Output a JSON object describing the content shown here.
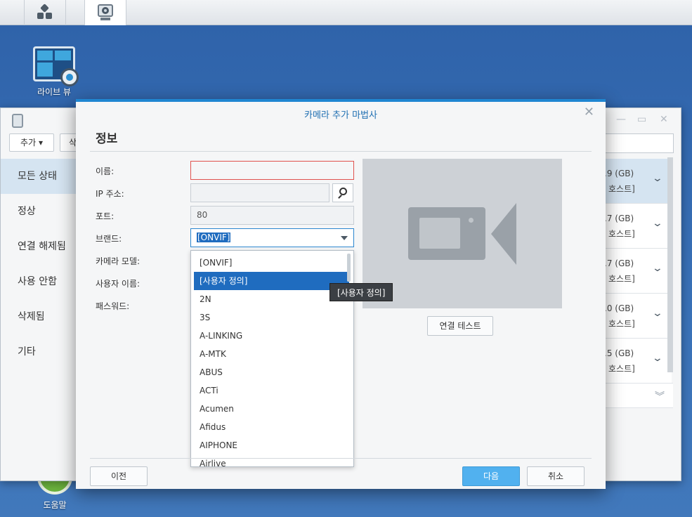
{
  "desktop": {
    "icons": [
      {
        "label": "라이브 뷰"
      },
      {
        "label": "도움말"
      }
    ]
  },
  "background_window": {
    "add_button": "추가",
    "add_button_2": "삭",
    "sidebar": [
      "모든 상태",
      "정상",
      "연결 해제됨",
      "사용 안함",
      "삭제됨",
      "기타"
    ],
    "cameras": [
      {
        "size": ".9 (GB)",
        "host": "호스트]"
      },
      {
        "size": ".7 (GB)",
        "host": "호스트]"
      },
      {
        "size": ".7 (GB)",
        "host": "호스트]"
      },
      {
        "size": ".0 (GB)",
        "host": "호스트]"
      },
      {
        "size": ".5 (GB)",
        "host": "호스트]"
      }
    ]
  },
  "dialog": {
    "title": "카메라 추가 마법사",
    "section": "정보",
    "labels": {
      "name": "이름:",
      "ip": "IP 주소:",
      "port": "포트:",
      "brand": "브랜드:",
      "model": "카메라 모델:",
      "username": "사용자 이름:",
      "password": "패스워드:"
    },
    "values": {
      "name": "",
      "ip": "",
      "port": "80",
      "brand": "[ONVIF]"
    },
    "brand_options": [
      "[ONVIF]",
      "[사용자 정의]",
      "2N",
      "3S",
      "A-LINKING",
      "A-MTK",
      "ABUS",
      "ACTi",
      "Acumen",
      "Afidus",
      "AIPHONE",
      "Airlive"
    ],
    "tooltip": "[사용자 정의]",
    "test_button": "연결 테스트",
    "prev_button": "이전",
    "next_button": "다음",
    "cancel_button": "취소"
  }
}
